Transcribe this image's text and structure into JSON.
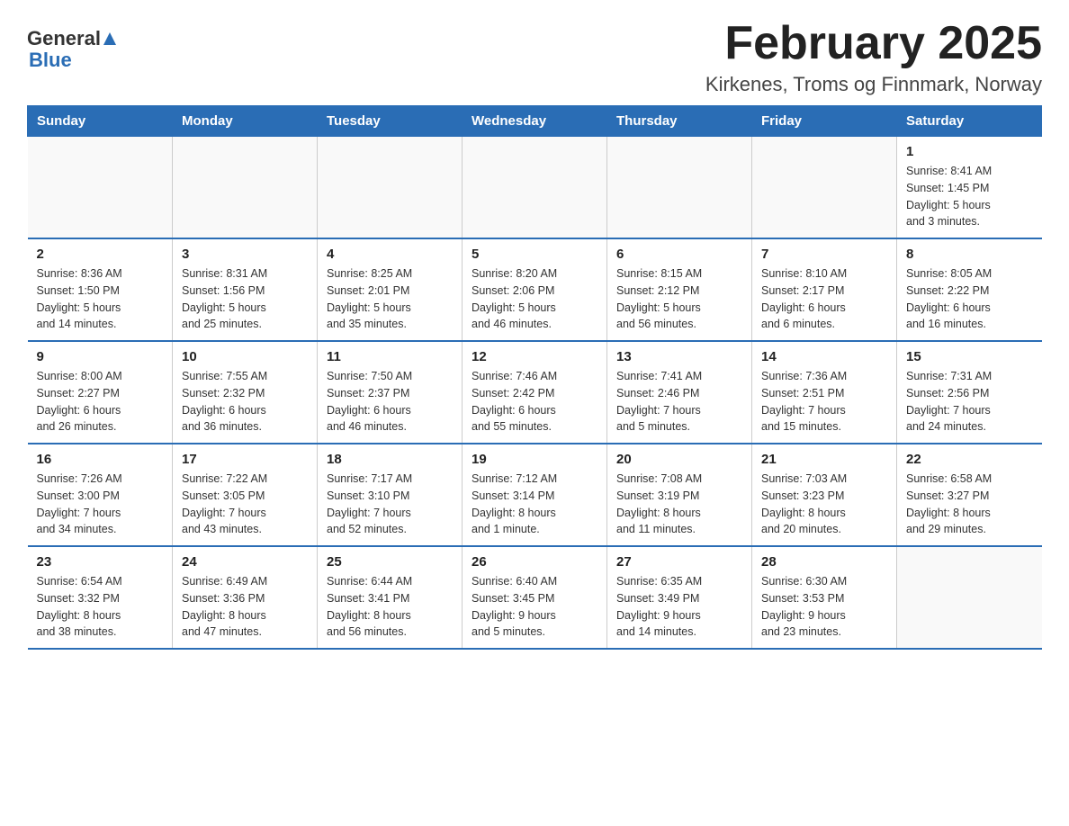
{
  "header": {
    "logo_general": "General",
    "logo_blue": "Blue",
    "month_title": "February 2025",
    "location": "Kirkenes, Troms og Finnmark, Norway"
  },
  "days_of_week": [
    "Sunday",
    "Monday",
    "Tuesday",
    "Wednesday",
    "Thursday",
    "Friday",
    "Saturday"
  ],
  "weeks": [
    [
      {
        "day": "",
        "info": ""
      },
      {
        "day": "",
        "info": ""
      },
      {
        "day": "",
        "info": ""
      },
      {
        "day": "",
        "info": ""
      },
      {
        "day": "",
        "info": ""
      },
      {
        "day": "",
        "info": ""
      },
      {
        "day": "1",
        "info": "Sunrise: 8:41 AM\nSunset: 1:45 PM\nDaylight: 5 hours\nand 3 minutes."
      }
    ],
    [
      {
        "day": "2",
        "info": "Sunrise: 8:36 AM\nSunset: 1:50 PM\nDaylight: 5 hours\nand 14 minutes."
      },
      {
        "day": "3",
        "info": "Sunrise: 8:31 AM\nSunset: 1:56 PM\nDaylight: 5 hours\nand 25 minutes."
      },
      {
        "day": "4",
        "info": "Sunrise: 8:25 AM\nSunset: 2:01 PM\nDaylight: 5 hours\nand 35 minutes."
      },
      {
        "day": "5",
        "info": "Sunrise: 8:20 AM\nSunset: 2:06 PM\nDaylight: 5 hours\nand 46 minutes."
      },
      {
        "day": "6",
        "info": "Sunrise: 8:15 AM\nSunset: 2:12 PM\nDaylight: 5 hours\nand 56 minutes."
      },
      {
        "day": "7",
        "info": "Sunrise: 8:10 AM\nSunset: 2:17 PM\nDaylight: 6 hours\nand 6 minutes."
      },
      {
        "day": "8",
        "info": "Sunrise: 8:05 AM\nSunset: 2:22 PM\nDaylight: 6 hours\nand 16 minutes."
      }
    ],
    [
      {
        "day": "9",
        "info": "Sunrise: 8:00 AM\nSunset: 2:27 PM\nDaylight: 6 hours\nand 26 minutes."
      },
      {
        "day": "10",
        "info": "Sunrise: 7:55 AM\nSunset: 2:32 PM\nDaylight: 6 hours\nand 36 minutes."
      },
      {
        "day": "11",
        "info": "Sunrise: 7:50 AM\nSunset: 2:37 PM\nDaylight: 6 hours\nand 46 minutes."
      },
      {
        "day": "12",
        "info": "Sunrise: 7:46 AM\nSunset: 2:42 PM\nDaylight: 6 hours\nand 55 minutes."
      },
      {
        "day": "13",
        "info": "Sunrise: 7:41 AM\nSunset: 2:46 PM\nDaylight: 7 hours\nand 5 minutes."
      },
      {
        "day": "14",
        "info": "Sunrise: 7:36 AM\nSunset: 2:51 PM\nDaylight: 7 hours\nand 15 minutes."
      },
      {
        "day": "15",
        "info": "Sunrise: 7:31 AM\nSunset: 2:56 PM\nDaylight: 7 hours\nand 24 minutes."
      }
    ],
    [
      {
        "day": "16",
        "info": "Sunrise: 7:26 AM\nSunset: 3:00 PM\nDaylight: 7 hours\nand 34 minutes."
      },
      {
        "day": "17",
        "info": "Sunrise: 7:22 AM\nSunset: 3:05 PM\nDaylight: 7 hours\nand 43 minutes."
      },
      {
        "day": "18",
        "info": "Sunrise: 7:17 AM\nSunset: 3:10 PM\nDaylight: 7 hours\nand 52 minutes."
      },
      {
        "day": "19",
        "info": "Sunrise: 7:12 AM\nSunset: 3:14 PM\nDaylight: 8 hours\nand 1 minute."
      },
      {
        "day": "20",
        "info": "Sunrise: 7:08 AM\nSunset: 3:19 PM\nDaylight: 8 hours\nand 11 minutes."
      },
      {
        "day": "21",
        "info": "Sunrise: 7:03 AM\nSunset: 3:23 PM\nDaylight: 8 hours\nand 20 minutes."
      },
      {
        "day": "22",
        "info": "Sunrise: 6:58 AM\nSunset: 3:27 PM\nDaylight: 8 hours\nand 29 minutes."
      }
    ],
    [
      {
        "day": "23",
        "info": "Sunrise: 6:54 AM\nSunset: 3:32 PM\nDaylight: 8 hours\nand 38 minutes."
      },
      {
        "day": "24",
        "info": "Sunrise: 6:49 AM\nSunset: 3:36 PM\nDaylight: 8 hours\nand 47 minutes."
      },
      {
        "day": "25",
        "info": "Sunrise: 6:44 AM\nSunset: 3:41 PM\nDaylight: 8 hours\nand 56 minutes."
      },
      {
        "day": "26",
        "info": "Sunrise: 6:40 AM\nSunset: 3:45 PM\nDaylight: 9 hours\nand 5 minutes."
      },
      {
        "day": "27",
        "info": "Sunrise: 6:35 AM\nSunset: 3:49 PM\nDaylight: 9 hours\nand 14 minutes."
      },
      {
        "day": "28",
        "info": "Sunrise: 6:30 AM\nSunset: 3:53 PM\nDaylight: 9 hours\nand 23 minutes."
      },
      {
        "day": "",
        "info": ""
      }
    ]
  ]
}
